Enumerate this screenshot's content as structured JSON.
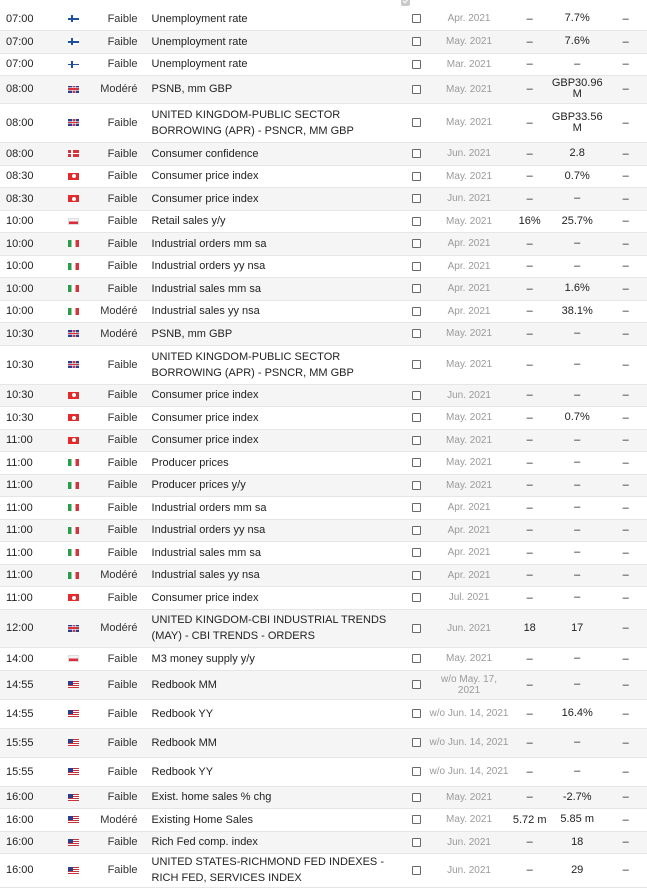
{
  "rows": [
    {
      "time": "07:00",
      "country": "fi",
      "importance": "Faible",
      "event": "Unemployment rate",
      "period": "Apr. 2021",
      "actual": "–",
      "forecast": "7.7%",
      "previous": "–"
    },
    {
      "time": "07:00",
      "country": "fi",
      "importance": "Faible",
      "event": "Unemployment rate",
      "period": "May. 2021",
      "actual": "–",
      "forecast": "7.6%",
      "previous": "–"
    },
    {
      "time": "07:00",
      "country": "fi",
      "importance": "Faible",
      "event": "Unemployment rate",
      "period": "Mar. 2021",
      "actual": "–",
      "forecast": "–",
      "previous": "–"
    },
    {
      "time": "08:00",
      "country": "gb",
      "importance": "Modéré",
      "event": "PSNB, mm GBP",
      "period": "May. 2021",
      "actual": "–",
      "forecast": "GBP30.96 M",
      "previous": "–"
    },
    {
      "time": "08:00",
      "country": "gb",
      "importance": "Faible",
      "event": "UNITED KINGDOM-PUBLIC SECTOR BORROWING (APR) - PSNCR, MM GBP",
      "period": "May. 2021",
      "actual": "–",
      "forecast": "GBP33.56 M",
      "previous": "–"
    },
    {
      "time": "08:00",
      "country": "dk",
      "importance": "Faible",
      "event": "Consumer confidence",
      "period": "Jun. 2021",
      "actual": "–",
      "forecast": "2.8",
      "previous": "–"
    },
    {
      "time": "08:30",
      "country": "tn",
      "importance": "Faible",
      "event": "Consumer price index",
      "period": "May. 2021",
      "actual": "–",
      "forecast": "0.7%",
      "previous": "–"
    },
    {
      "time": "08:30",
      "country": "tn",
      "importance": "Faible",
      "event": "Consumer price index",
      "period": "Jun. 2021",
      "actual": "–",
      "forecast": "–",
      "previous": "–"
    },
    {
      "time": "10:00",
      "country": "pl",
      "importance": "Faible",
      "event": "Retail sales y/y",
      "period": "May. 2021",
      "actual": "16%",
      "forecast": "25.7%",
      "previous": "–"
    },
    {
      "time": "10:00",
      "country": "it",
      "importance": "Faible",
      "event": "Industrial orders mm sa",
      "period": "Apr. 2021",
      "actual": "–",
      "forecast": "–",
      "previous": "–"
    },
    {
      "time": "10:00",
      "country": "it",
      "importance": "Faible",
      "event": "Industrial orders yy nsa",
      "period": "Apr. 2021",
      "actual": "–",
      "forecast": "–",
      "previous": "–"
    },
    {
      "time": "10:00",
      "country": "it",
      "importance": "Faible",
      "event": "Industrial sales mm sa",
      "period": "Apr. 2021",
      "actual": "–",
      "forecast": "1.6%",
      "previous": "–"
    },
    {
      "time": "10:00",
      "country": "it",
      "importance": "Modéré",
      "event": "Industrial sales yy nsa",
      "period": "Apr. 2021",
      "actual": "–",
      "forecast": "38.1%",
      "previous": "–"
    },
    {
      "time": "10:30",
      "country": "gb",
      "importance": "Modéré",
      "event": "PSNB, mm GBP",
      "period": "May. 2021",
      "actual": "–",
      "forecast": "–",
      "previous": "–"
    },
    {
      "time": "10:30",
      "country": "gb",
      "importance": "Faible",
      "event": "UNITED KINGDOM-PUBLIC SECTOR BORROWING (APR) - PSNCR, MM GBP",
      "period": "May. 2021",
      "actual": "–",
      "forecast": "–",
      "previous": "–"
    },
    {
      "time": "10:30",
      "country": "tn",
      "importance": "Faible",
      "event": "Consumer price index",
      "period": "Jun. 2021",
      "actual": "–",
      "forecast": "–",
      "previous": "–"
    },
    {
      "time": "10:30",
      "country": "tn",
      "importance": "Faible",
      "event": "Consumer price index",
      "period": "May. 2021",
      "actual": "–",
      "forecast": "0.7%",
      "previous": "–"
    },
    {
      "time": "11:00",
      "country": "tn",
      "importance": "Faible",
      "event": "Consumer price index",
      "period": "May. 2021",
      "actual": "–",
      "forecast": "–",
      "previous": "–"
    },
    {
      "time": "11:00",
      "country": "it",
      "importance": "Faible",
      "event": "Producer prices",
      "period": "May. 2021",
      "actual": "–",
      "forecast": "–",
      "previous": "–"
    },
    {
      "time": "11:00",
      "country": "it",
      "importance": "Faible",
      "event": "Producer prices y/y",
      "period": "May. 2021",
      "actual": "–",
      "forecast": "–",
      "previous": "–"
    },
    {
      "time": "11:00",
      "country": "it",
      "importance": "Faible",
      "event": "Industrial orders mm sa",
      "period": "Apr. 2021",
      "actual": "–",
      "forecast": "–",
      "previous": "–"
    },
    {
      "time": "11:00",
      "country": "it",
      "importance": "Faible",
      "event": "Industrial orders yy nsa",
      "period": "Apr. 2021",
      "actual": "–",
      "forecast": "–",
      "previous": "–"
    },
    {
      "time": "11:00",
      "country": "it",
      "importance": "Faible",
      "event": "Industrial sales mm sa",
      "period": "Apr. 2021",
      "actual": "–",
      "forecast": "–",
      "previous": "–"
    },
    {
      "time": "11:00",
      "country": "it",
      "importance": "Modéré",
      "event": "Industrial sales yy nsa",
      "period": "Apr. 2021",
      "actual": "–",
      "forecast": "–",
      "previous": "–"
    },
    {
      "time": "11:00",
      "country": "tn",
      "importance": "Faible",
      "event": "Consumer price index",
      "period": "Jul. 2021",
      "actual": "–",
      "forecast": "–",
      "previous": "–"
    },
    {
      "time": "12:00",
      "country": "gb",
      "importance": "Modéré",
      "event": "UNITED KINGDOM-CBI INDUSTRIAL TRENDS (MAY) - CBI TRENDS - ORDERS",
      "period": "Jun. 2021",
      "actual": "18",
      "forecast": "17",
      "previous": "–"
    },
    {
      "time": "14:00",
      "country": "pl",
      "importance": "Faible",
      "event": "M3 money supply y/y",
      "period": "May. 2021",
      "actual": "–",
      "forecast": "–",
      "previous": "–"
    },
    {
      "time": "14:55",
      "country": "us",
      "importance": "Faible",
      "event": "Redbook MM",
      "period": "w/o May. 17, 2021",
      "actual": "–",
      "forecast": "–",
      "previous": "–"
    },
    {
      "time": "14:55",
      "country": "us",
      "importance": "Faible",
      "event": "Redbook YY",
      "period": "w/o Jun. 14, 2021",
      "actual": "–",
      "forecast": "16.4%",
      "previous": "–"
    },
    {
      "time": "15:55",
      "country": "us",
      "importance": "Faible",
      "event": "Redbook MM",
      "period": "w/o Jun. 14, 2021",
      "actual": "–",
      "forecast": "–",
      "previous": "–"
    },
    {
      "time": "15:55",
      "country": "us",
      "importance": "Faible",
      "event": "Redbook YY",
      "period": "w/o Jun. 14, 2021",
      "actual": "–",
      "forecast": "–",
      "previous": "–"
    },
    {
      "time": "16:00",
      "country": "us",
      "importance": "Faible",
      "event": "Exist. home sales % chg",
      "period": "May. 2021",
      "actual": "–",
      "forecast": "-2.7%",
      "previous": "–"
    },
    {
      "time": "16:00",
      "country": "us",
      "importance": "Modéré",
      "event": "Existing Home Sales",
      "period": "May. 2021",
      "actual": "5.72 m",
      "forecast": "5.85 m",
      "previous": "–"
    },
    {
      "time": "16:00",
      "country": "us",
      "importance": "Faible",
      "event": "Rich Fed comp. index",
      "period": "Jun. 2021",
      "actual": "–",
      "forecast": "18",
      "previous": "–"
    },
    {
      "time": "16:00",
      "country": "us",
      "importance": "Faible",
      "event": "UNITED STATES-RICHMOND FED INDEXES - RICH FED, SERVICES INDEX",
      "period": "Jun. 2021",
      "actual": "–",
      "forecast": "29",
      "previous": "–"
    }
  ]
}
